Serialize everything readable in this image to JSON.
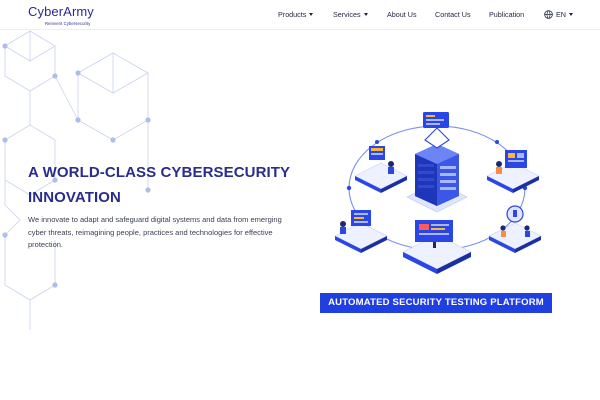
{
  "brand": {
    "name": "CyberArmy",
    "tagline": "Reinvent Cybersecurity"
  },
  "nav": {
    "products": "Products",
    "services": "Services",
    "about": "About Us",
    "contact": "Contact Us",
    "publication": "Publication",
    "language": "EN"
  },
  "icons": {
    "language": "globe-icon",
    "dropdown": "caret-down-icon"
  },
  "hero": {
    "title": "A WORLD-CLASS CYBERSECURITY INNOVATION",
    "description": "We innovate to adapt and safeguard digital systems and data from emerging cyber threats, reimagining people, practices and technologies for effective protection."
  },
  "banner": {
    "label": "AUTOMATED SECURITY TESTING PLATFORM"
  },
  "colors": {
    "brand": "#2a2c8c",
    "accent": "#1f3fe0",
    "mesh": "#c9d3f0"
  }
}
